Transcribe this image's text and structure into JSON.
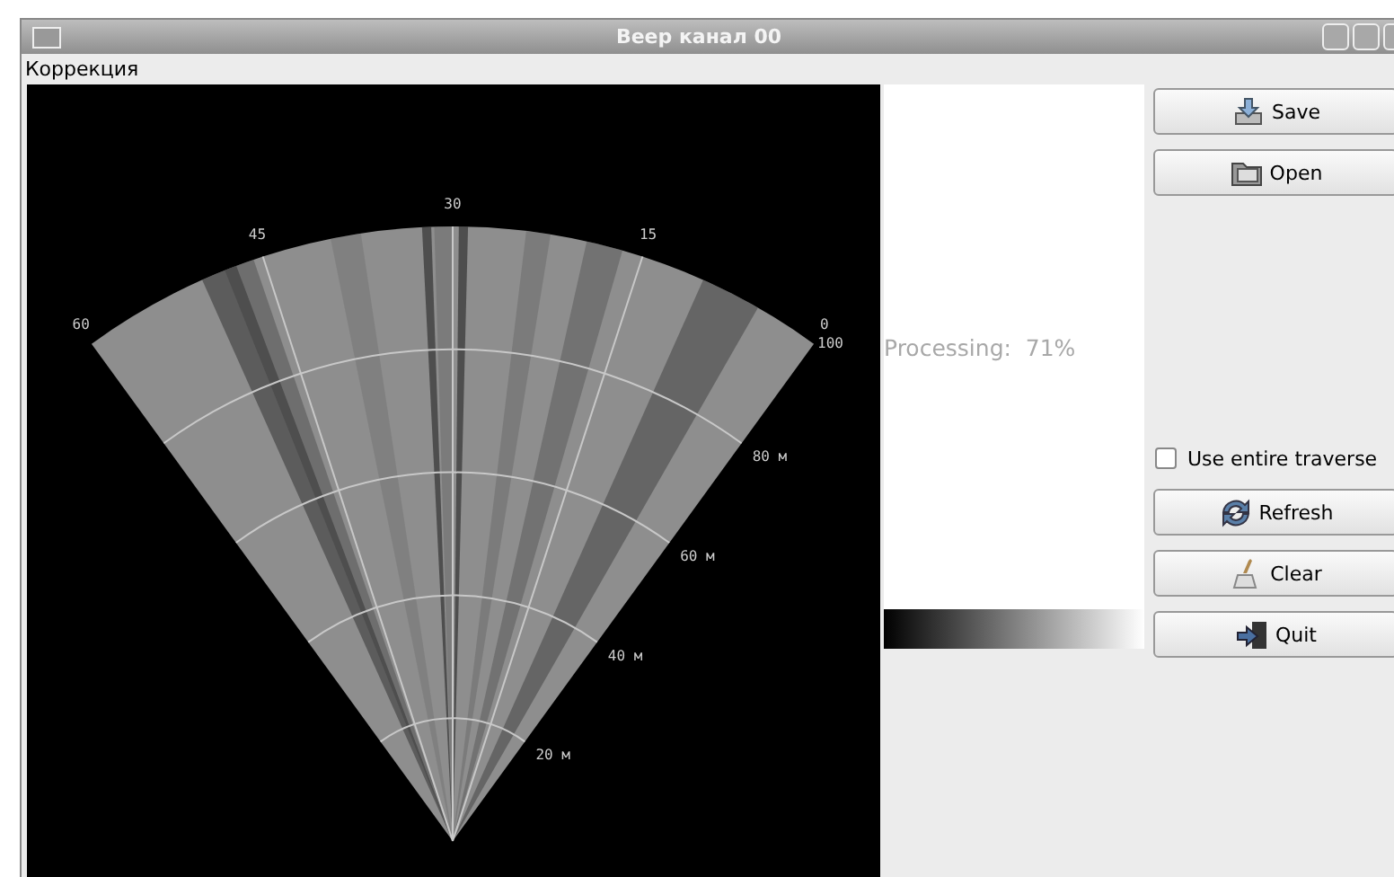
{
  "window": {
    "title": "Веер канал 00"
  },
  "menu": [
    "Коррекция"
  ],
  "fan": {
    "angle_labels": [
      "60",
      "45",
      "30",
      "15",
      "0"
    ],
    "range_labels": [
      "100",
      "80 м",
      "60 м",
      "40 м",
      "20 м"
    ]
  },
  "status": {
    "text": "Processing:  71%"
  },
  "buttons_top": [
    {
      "label": "Save",
      "kind": "save"
    },
    {
      "label": "Open",
      "kind": "open"
    }
  ],
  "checkbox": {
    "label": "Use entire traverse",
    "checked": false
  },
  "buttons_bottom": [
    {
      "label": "Refresh",
      "kind": "refresh"
    },
    {
      "label": "Clear",
      "kind": "clear"
    },
    {
      "label": "Quit",
      "kind": "quit"
    }
  ]
}
